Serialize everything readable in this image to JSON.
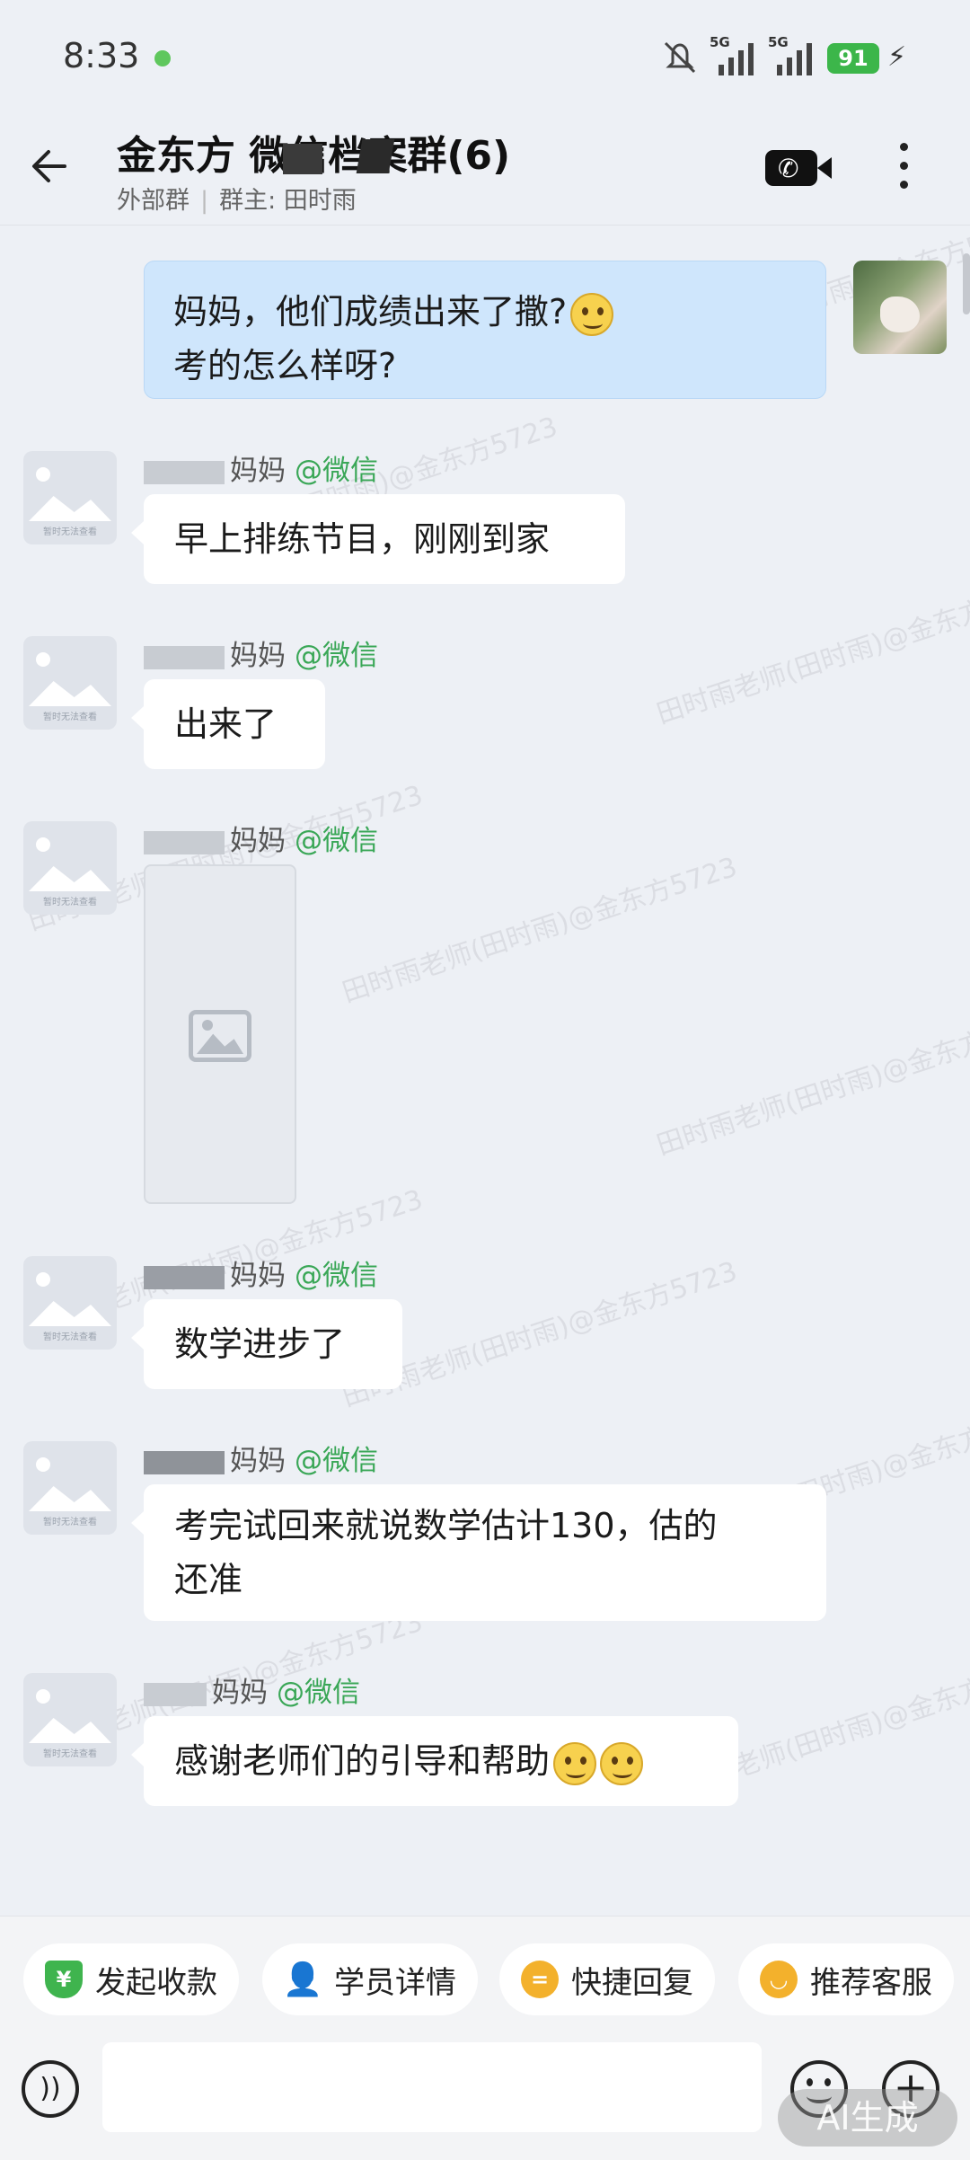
{
  "status_bar": {
    "time": "8:33",
    "network_1": "5G",
    "network_2": "5G",
    "battery": "91"
  },
  "header": {
    "title": "金东方    微信档案群(6)",
    "type_label": "外部群",
    "owner_label": "群主: 田时雨"
  },
  "watermark": "田时雨老师(田时雨)@金东方5723",
  "messages": {
    "self": {
      "line1": "妈妈，他们成绩出来了撒?",
      "line2": "考的怎么样呀?"
    },
    "m1": {
      "sender": "妈妈",
      "source": "@微信",
      "text": "早上排练节目，刚刚到家"
    },
    "m2": {
      "sender": "妈妈",
      "source": "@微信",
      "text": "出来了"
    },
    "m3": {
      "sender": "妈妈",
      "source": "@微信"
    },
    "m4": {
      "sender": "妈妈",
      "source": "@微信",
      "text": "数学进步了"
    },
    "m5": {
      "sender": "妈妈",
      "source": "@微信",
      "line1": "考完试回来就说数学估计130，估的",
      "line2": "还准"
    },
    "m6": {
      "sender": "妈妈",
      "source": "@微信",
      "text": "感谢老师们的引导和帮助"
    }
  },
  "avatar_caption": "暂时无法查看",
  "quick_actions": [
    "发起收款",
    "学员详情",
    "快捷回复",
    "推荐客服"
  ],
  "input": {
    "ai_badge": "AI生成"
  },
  "colors": {
    "self_bubble": "#cfe6fc",
    "source_green": "#3aa757",
    "background": "#edf0f5"
  }
}
